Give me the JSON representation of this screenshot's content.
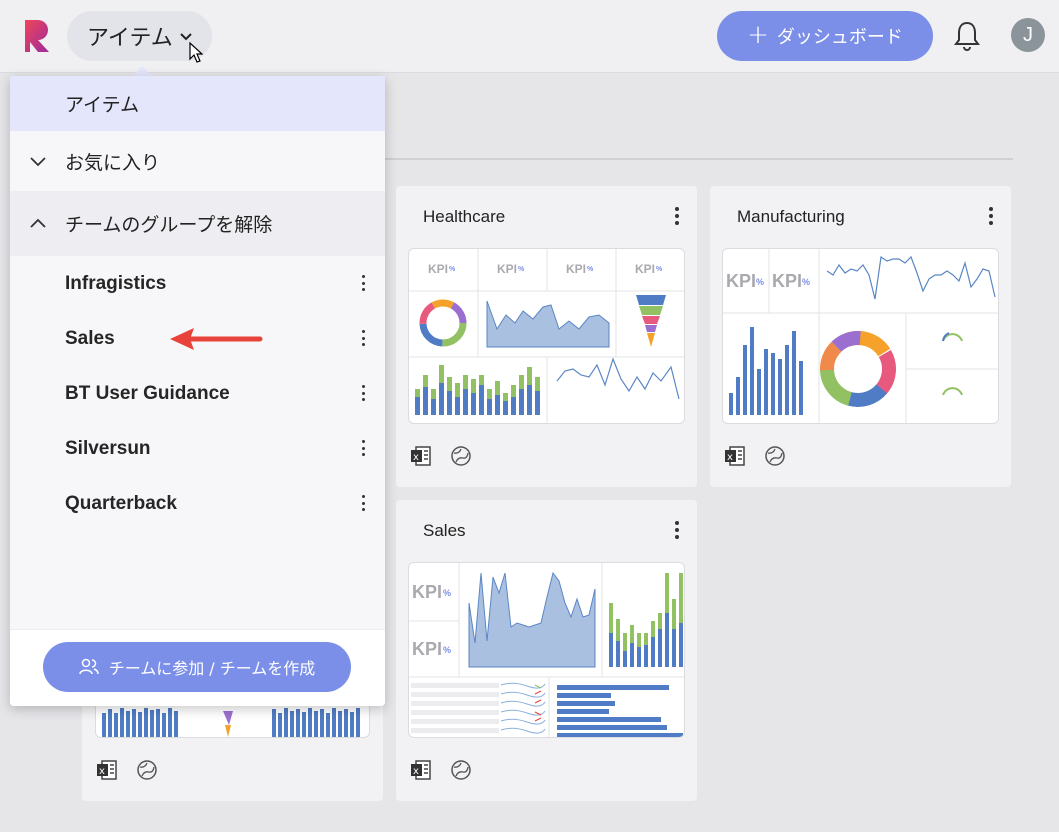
{
  "header": {
    "items_label": "アイテム",
    "new_dashboard_label": "ダッシュボード",
    "avatar_initial": "J"
  },
  "dropdown": {
    "selected_label": "アイテム",
    "favorites_label": "お気に入り",
    "ungroup_label": "チームのグループを解除",
    "teams": [
      "Infragistics",
      "Sales",
      "BT User Guidance",
      "Silversun",
      "Quarterback"
    ],
    "join_button_label": "チームに参加 / チームを作成"
  },
  "cards": {
    "healthcare": {
      "title": "Healthcare",
      "kpi_label": "KPI"
    },
    "manufacturing": {
      "title": "Manufacturing",
      "kpi_label": "KPI"
    },
    "sales": {
      "title": "Sales",
      "kpi_label": "KPI"
    }
  },
  "icons": {
    "logo": "reveal-logo",
    "items_chevron": "chevron-down-icon",
    "plus": "plus-icon",
    "bell": "bell-icon",
    "excel": "excel-icon",
    "web": "globe-icon",
    "kebab": "more-vertical-icon",
    "team_icon": "users-icon"
  },
  "colors": {
    "accent": "#7b8fe8",
    "selected_row": "#e4e6fb",
    "chart_blue": "#4f7cc4",
    "chart_green": "#91c163",
    "arrow_red": "#e8433b"
  }
}
